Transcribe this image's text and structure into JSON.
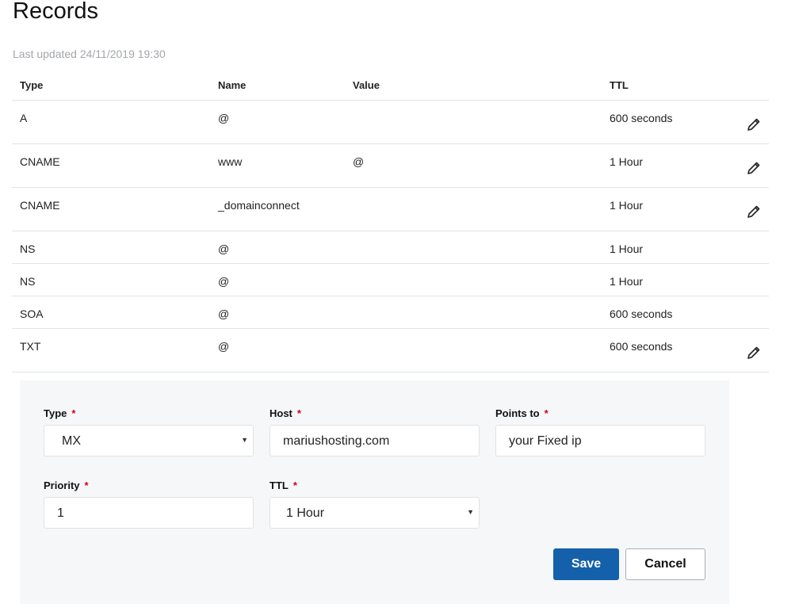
{
  "title": "Records",
  "last_updated": "Last updated 24/11/2019 19:30",
  "columns": [
    "Type",
    "Name",
    "Value",
    "TTL"
  ],
  "rows": [
    {
      "type": "A",
      "name": "@",
      "value": "",
      "ttl": "600 seconds",
      "editable": true
    },
    {
      "type": "CNAME",
      "name": "www",
      "value": "@",
      "ttl": "1 Hour",
      "editable": true
    },
    {
      "type": "CNAME",
      "name": "_domainconnect",
      "value": "",
      "ttl": "1 Hour",
      "editable": true
    },
    {
      "type": "NS",
      "name": "@",
      "value": "",
      "ttl": "1 Hour",
      "editable": false
    },
    {
      "type": "NS",
      "name": "@",
      "value": "",
      "ttl": "1 Hour",
      "editable": false
    },
    {
      "type": "SOA",
      "name": "@",
      "value": "",
      "ttl": "600 seconds",
      "editable": false
    },
    {
      "type": "TXT",
      "name": "@",
      "value": "",
      "ttl": "600 seconds",
      "editable": true
    }
  ],
  "form": {
    "type_label": "Type",
    "type_value": "MX",
    "host_label": "Host",
    "host_value": "mariushosting.com",
    "points_label": "Points to",
    "points_value": "your Fixed ip",
    "priority_label": "Priority",
    "priority_value": "1",
    "ttl_label": "TTL",
    "ttl_value": "1 Hour",
    "required_mark": "*",
    "save": "Save",
    "cancel": "Cancel"
  },
  "colors": {
    "primary": "#1460aa",
    "required": "#d0021b",
    "panel": "#f5f7f8"
  }
}
